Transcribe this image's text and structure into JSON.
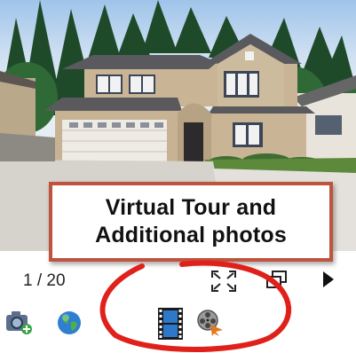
{
  "viewer": {
    "counter_text": "1 / 20",
    "callout_line1": "Virtual Tour and",
    "callout_line2": "Additional photos"
  },
  "icons": {
    "controls": [
      "fullscreen-icon",
      "window-icon",
      "next-icon"
    ],
    "bottom": [
      "camera-icon",
      "globe-icon",
      "film-icon",
      "reel-icon"
    ]
  },
  "colors": {
    "callout_border": "#c0533d",
    "highlight_ellipse": "#e0201b",
    "house_wall": "#c9b596",
    "roof": "#5a5a5e"
  }
}
